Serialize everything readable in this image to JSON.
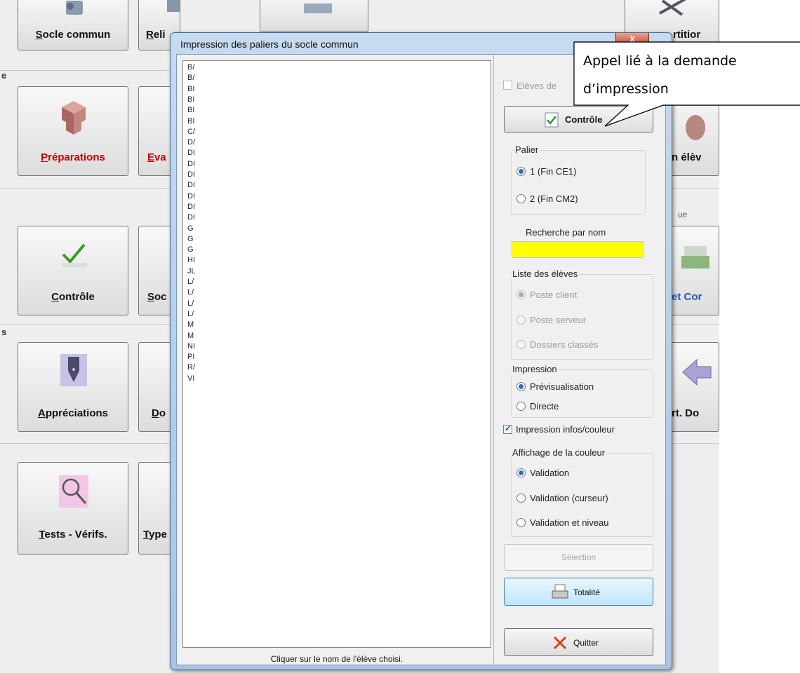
{
  "background": {
    "section_letters": [
      "e",
      "s"
    ],
    "tiles": [
      {
        "label": "Socle commun",
        "icon": "socle-icon"
      },
      {
        "label": "Préparations",
        "icon": "cubes-icon",
        "color": "#c00000"
      },
      {
        "label": "Contrôle",
        "icon": "checkmark-icon"
      },
      {
        "label": "Appréciations",
        "icon": "pen-nib-icon"
      },
      {
        "label": "Tests - Vérifs.",
        "icon": "magnifier-icon"
      }
    ],
    "partial_tiles": [
      "Reli",
      "Eva",
      "Soc",
      "Do",
      "Type"
    ],
    "right_tiles": [
      "rtitior",
      "n élèv",
      "et Cor",
      "rt. Do"
    ],
    "right_text": "ue"
  },
  "dialog": {
    "title": "Impression des paliers du socle commun",
    "close_label": "X",
    "student_list": {
      "items": [
        "B/",
        "B/",
        "BI",
        "BI",
        "BI",
        "BI",
        "C/",
        "D/",
        "DI",
        "DI",
        "DI",
        "DI",
        "DI",
        "DI",
        "DI",
        "G",
        "G",
        "G",
        "HI",
        "JL",
        "L/",
        "L/",
        "L/",
        "L/",
        "M",
        "M",
        "NI",
        "PI",
        "R/",
        "VI"
      ],
      "hint": "Cliquer sur le nom de l'élève choisi."
    },
    "eleves_checkbox_label": "Elèves de",
    "controle_button": "Contrôle",
    "palier": {
      "title": "Palier",
      "options": [
        "1 (Fin CE1)",
        "2 (Fin CM2)"
      ],
      "selected": 0
    },
    "search": {
      "label": "Recherche par nom",
      "value": ""
    },
    "liste_eleves": {
      "title": "Liste des élèves",
      "options": [
        "Poste client",
        "Poste serveur",
        "Dossiers classés"
      ],
      "selected": 0
    },
    "impression": {
      "title": "Impression",
      "options": [
        "Prévisualisation",
        "Directe"
      ],
      "selected": 0
    },
    "infos_couleur_label": "Impression infos/couleur",
    "infos_couleur_checked": true,
    "affichage_couleur": {
      "title": "Affichage de la couleur",
      "options": [
        "Validation",
        "Validation (curseur)",
        "Validation et niveau"
      ],
      "selected": 0
    },
    "selection_button": "Sélection",
    "totalite_button": "Totalité",
    "quitter_button": "Quitter"
  },
  "callout": {
    "line1": "Appel  lié à la demande",
    "line2": "d’impression"
  },
  "colors": {
    "search_highlight": "#ffff00",
    "accent_red": "#c00000",
    "window_frame": "#b4cde9"
  }
}
